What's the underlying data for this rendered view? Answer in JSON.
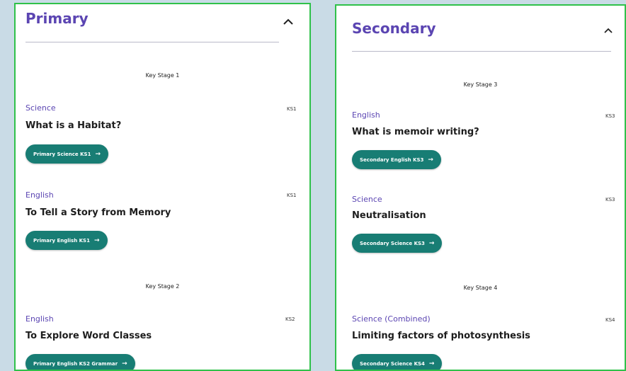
{
  "primary": {
    "title": "Primary",
    "groups": [
      {
        "stage": "Key Stage 1",
        "lessons": [
          {
            "subject": "Science",
            "badge": "KS1",
            "title": "What is a Habitat?",
            "button": "Primary Science KS1"
          },
          {
            "subject": "English",
            "badge": "KS1",
            "title": "To Tell a Story from Memory",
            "button": "Primary English KS1"
          }
        ]
      },
      {
        "stage": "Key Stage 2",
        "lessons": [
          {
            "subject": "English",
            "badge": "KS2",
            "title": "To Explore Word Classes",
            "button": "Primary English KS2 Grammar"
          }
        ]
      }
    ]
  },
  "secondary": {
    "title": "Secondary",
    "groups": [
      {
        "stage": "Key Stage 3",
        "lessons": [
          {
            "subject": "English",
            "badge": "KS3",
            "title": "What is memoir writing?",
            "button": "Secondary English KS3"
          },
          {
            "subject": "Science",
            "badge": "KS3",
            "title": "Neutralisation",
            "button": "Secondary Science KS3"
          }
        ]
      },
      {
        "stage": "Key Stage 4",
        "lessons": [
          {
            "subject": "Science (Combined)",
            "badge": "KS4",
            "title": "Limiting factors of photosynthesis",
            "button": "Secondary Science KS4"
          }
        ]
      }
    ]
  },
  "icons": {
    "collapse": "chevron-up-icon",
    "button_arrow": "arrow-right-icon"
  },
  "colors": {
    "accent_purple": "#5b45b2",
    "button_teal": "#187d74",
    "panel_border": "#2fc14a",
    "background": "#c9dbe6"
  }
}
